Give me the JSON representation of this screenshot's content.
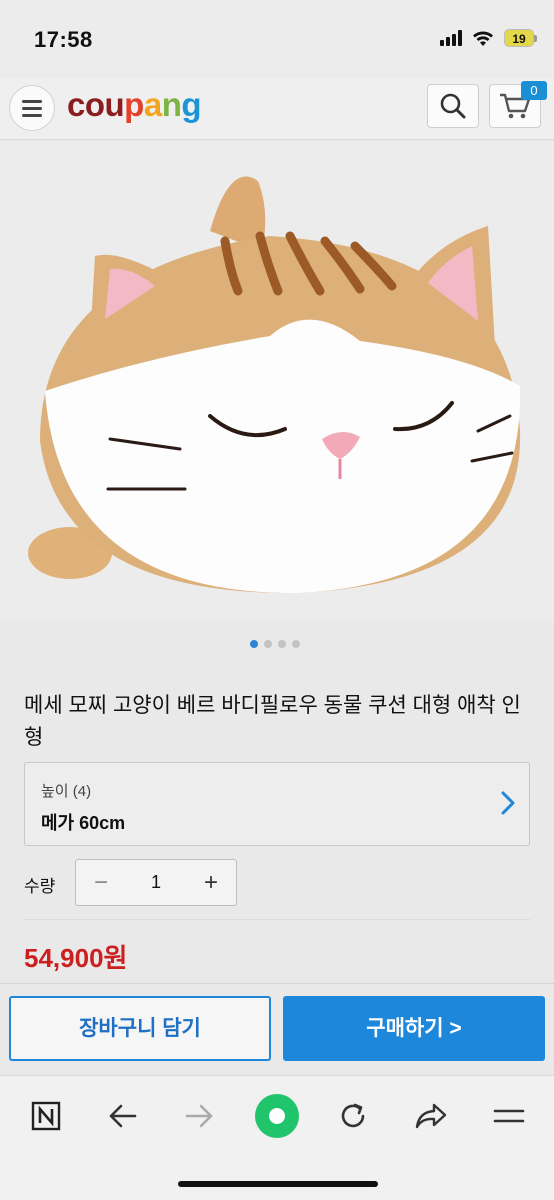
{
  "status_bar": {
    "time": "17:58",
    "battery": "19"
  },
  "header": {
    "logo_parts": [
      "cou",
      "p",
      "a",
      "n",
      "g"
    ],
    "cart_count": "0"
  },
  "product": {
    "title": "메세 모찌 고양이 베르 바디필로우 동물 쿠션 대형 애착 인형",
    "image_dots": 4,
    "active_dot": 0
  },
  "option": {
    "label": "높이 (4)",
    "value": "메가 60cm"
  },
  "quantity": {
    "label": "수량",
    "minus": "−",
    "value": "1",
    "plus": "+"
  },
  "price": "54,900원",
  "buttons": {
    "add_to_cart": "장바구니 담기",
    "buy_now": "구매하기 >"
  },
  "colors": {
    "accent": "#1d87db",
    "price": "#cc1f1f"
  }
}
